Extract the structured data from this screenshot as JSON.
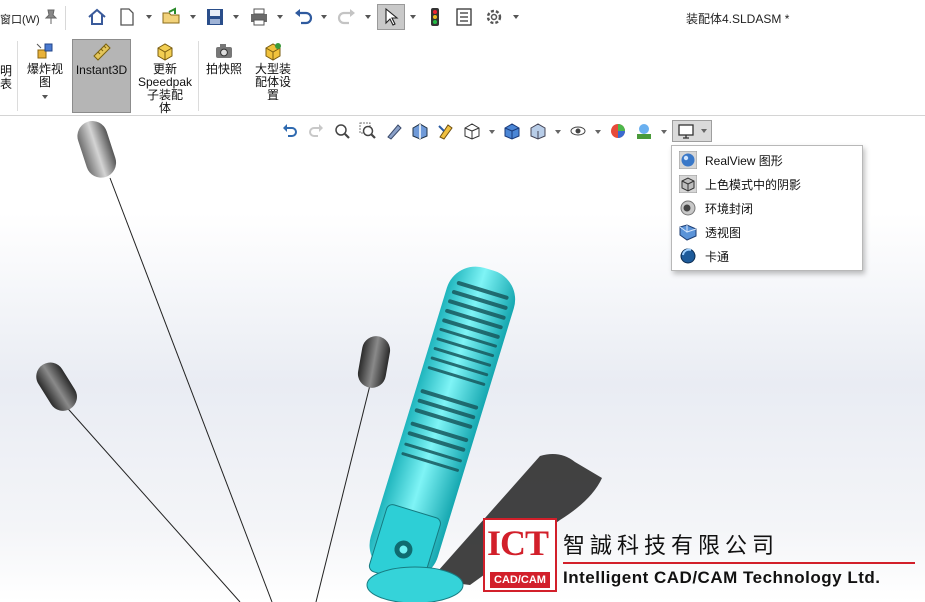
{
  "titlebar": {
    "menu_fragment": "窗口(W)",
    "document_title": "装配体4.SLDASM *"
  },
  "ribbon": {
    "partial_label_1": "明",
    "partial_label_2": "表",
    "explode_label_1": "爆炸视",
    "explode_label_2": "图",
    "instant3d_label": "Instant3D",
    "speedpak_label_1": "更新",
    "speedpak_label_2": "Speedpak",
    "speedpak_label_3": "子装配",
    "speedpak_label_4": "体",
    "snapshot_label": "拍快照",
    "large_label_1": "大型装",
    "large_label_2": "配体设",
    "large_label_3": "置"
  },
  "display_menu": {
    "items": [
      {
        "label": "RealView 图形",
        "icon": "realview-sphere-icon"
      },
      {
        "label": "上色模式中的阴影",
        "icon": "shadow-cube-icon"
      },
      {
        "label": "环境封闭",
        "icon": "ambient-occlusion-icon"
      },
      {
        "label": "透视图",
        "icon": "perspective-box-icon"
      },
      {
        "label": "卡通",
        "icon": "cartoon-sphere-icon"
      }
    ]
  },
  "logo": {
    "mark": "ICT",
    "sub": "CAD/CAM",
    "chinese_name": "智誠科技有限公司",
    "english_name": "Intelligent CAD/CAM Technology Ltd."
  },
  "colors": {
    "model_cyan": "#35e0e6",
    "logo_red": "#d21f2a",
    "active_button": "#b5b5b5"
  }
}
